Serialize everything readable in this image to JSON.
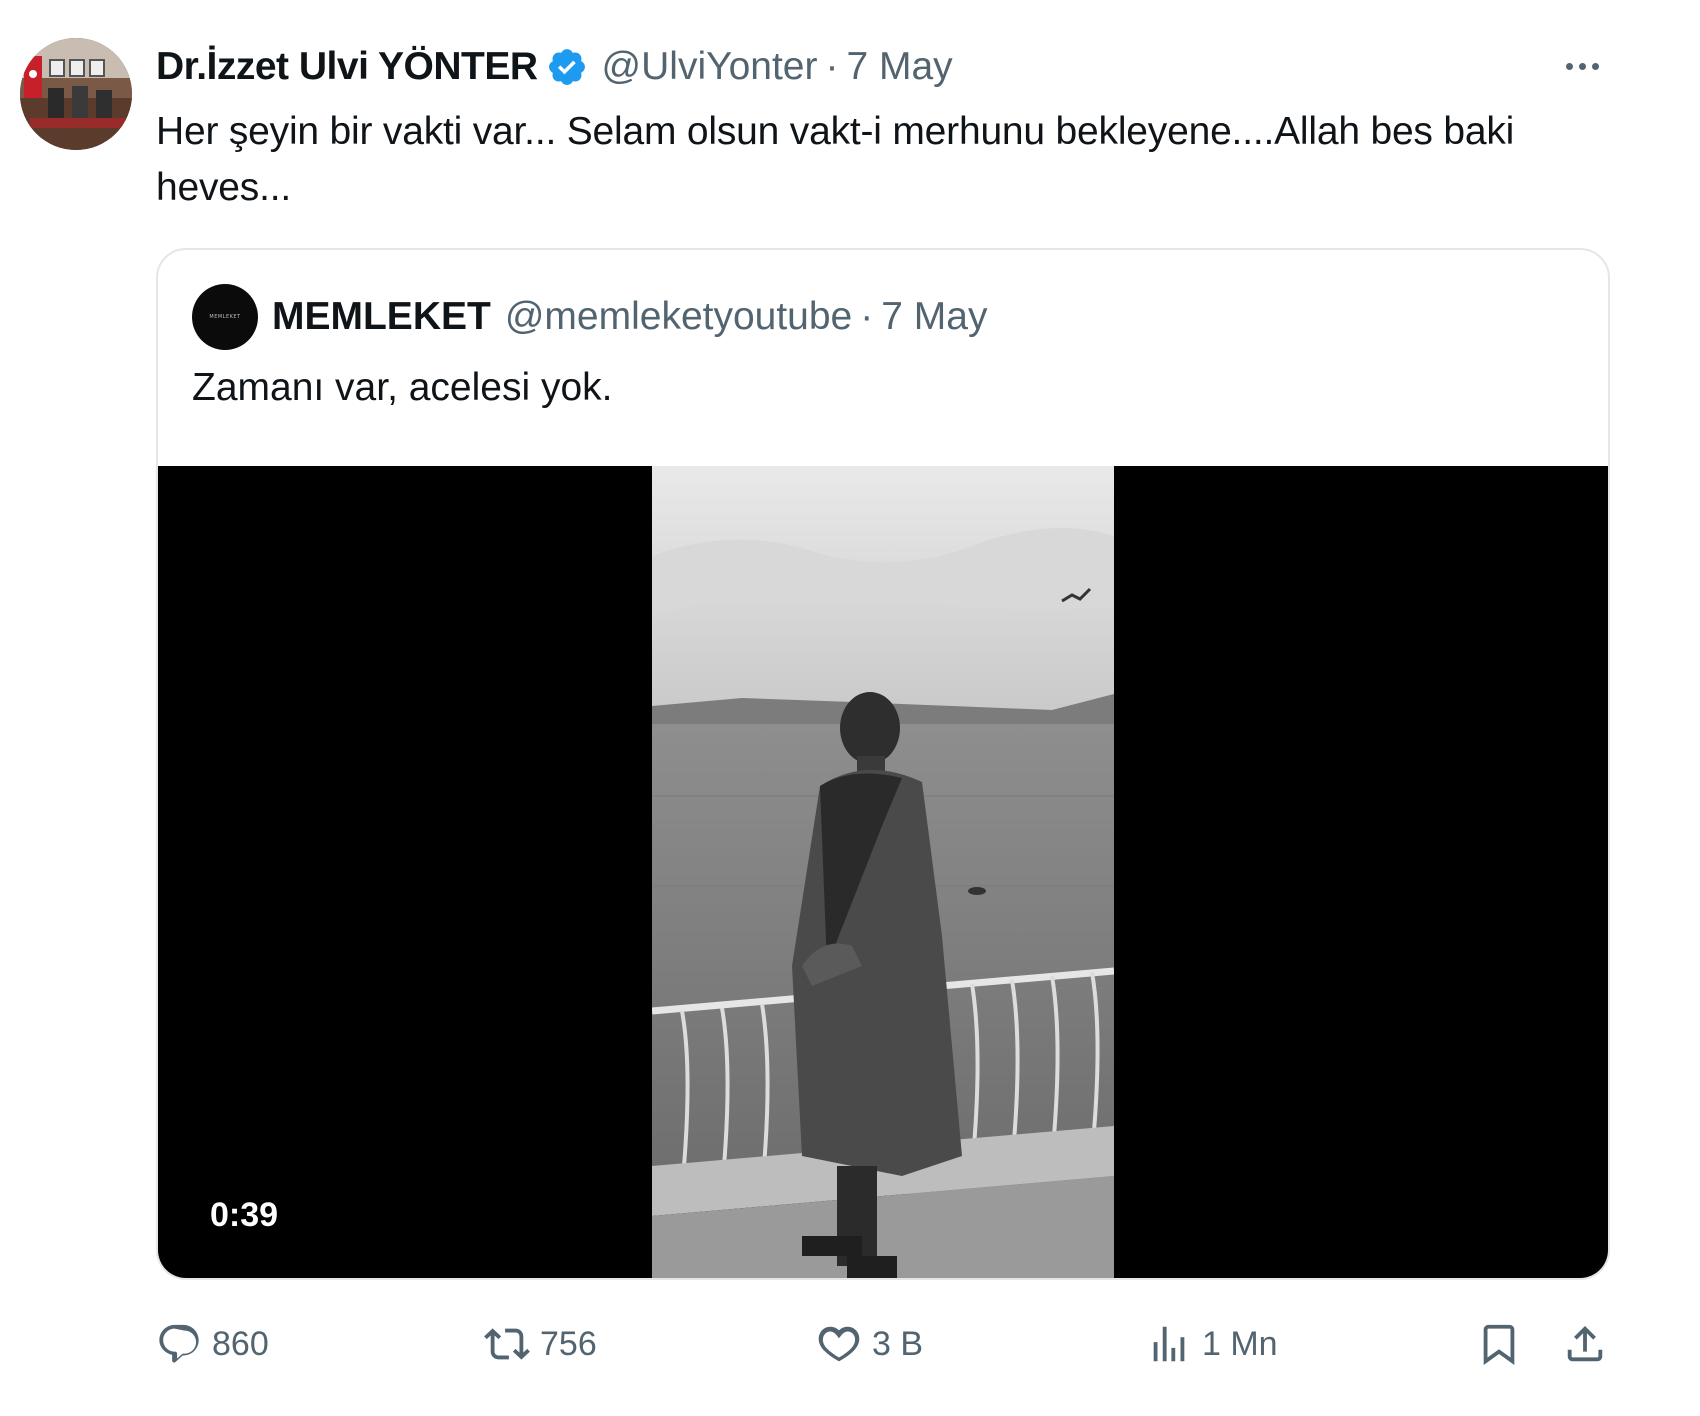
{
  "author": {
    "name": "Dr.İzzet Ulvi YÖNTER",
    "handle": "@UlviYonter",
    "separator": "·",
    "date": "7 May",
    "verified_color": "#1d9bf0"
  },
  "tweet": {
    "text": "Her şeyin bir vakti var... Selam olsun vakt-i merhunu bekleyene....Allah bes baki heves..."
  },
  "quote": {
    "name": "MEMLEKET",
    "handle": "@memleketyoutube",
    "separator": "·",
    "date": "7 May",
    "avatar_text": "MEMLEKET",
    "text": "Zamanı var, acelesi yok.",
    "video": {
      "duration": "0:39"
    }
  },
  "actions": {
    "replies": "860",
    "retweets": "756",
    "likes": "3 B",
    "views": "1 Mn"
  },
  "icons": {
    "more": "more-icon",
    "reply": "reply-icon",
    "retweet": "retweet-icon",
    "like": "heart-icon",
    "views": "views-icon",
    "bookmark": "bookmark-icon",
    "share": "share-icon"
  },
  "colors": {
    "text": "#0f1419",
    "secondary": "#536471",
    "border": "#e3e7ea"
  }
}
